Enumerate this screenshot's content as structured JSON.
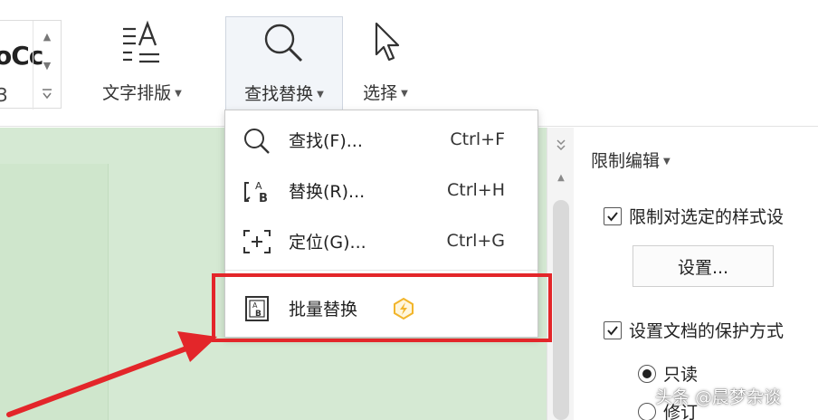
{
  "ribbon": {
    "style_preview_text": "oCc",
    "style_preview_sub": "3",
    "text_layout_label": "文字排版",
    "find_replace_label": "查找替换",
    "select_label": "选择"
  },
  "menu": {
    "items": [
      {
        "label": "查找(F)...",
        "shortcut": "Ctrl+F",
        "icon": "search-icon"
      },
      {
        "label": "替换(R)...",
        "shortcut": "Ctrl+H",
        "icon": "replace-icon"
      },
      {
        "label": "定位(G)...",
        "shortcut": "Ctrl+G",
        "icon": "goto-icon"
      }
    ],
    "batch_replace_label": "批量替换",
    "batch_icon": "batch-replace-icon",
    "badge_icon": "premium-badge-icon"
  },
  "pane": {
    "title": "限制编辑",
    "restrict_style_label": "限制对选定的样式设",
    "restrict_style_checked": true,
    "settings_button": "设置...",
    "protect_label": "设置文档的保护方式",
    "protect_checked": true,
    "radio_readonly": "只读",
    "radio_revision": "修订",
    "readonly_selected": true
  },
  "annotation": {
    "highlight_color": "#e3262a"
  },
  "watermark": "头条 @晨梦杂谈",
  "colors": {
    "doc_background": "#d5e9d3",
    "accent_red": "#e3262a",
    "badge_gold": "#f2b52b"
  }
}
